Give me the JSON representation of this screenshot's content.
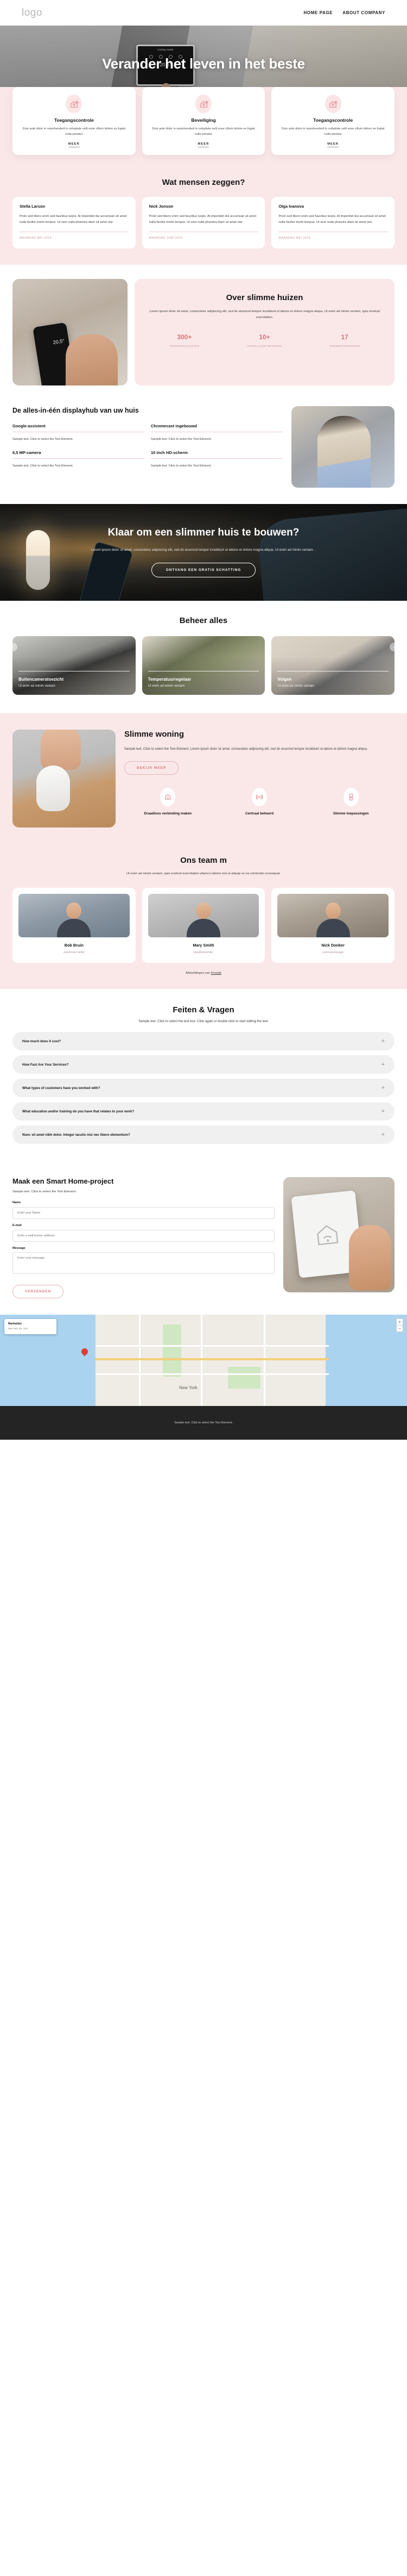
{
  "header": {
    "logo": "logo",
    "nav": [
      {
        "label": "HOME PAGE"
      },
      {
        "label": "ABOUT COMPANY"
      }
    ]
  },
  "hero": {
    "title": "Verander het leven in het beste",
    "panel_title": "Living room",
    "panel_temp": "20,5°"
  },
  "features": {
    "cards": [
      {
        "icon": "smart-home-icon",
        "title": "Toegangscontrole",
        "text": "Duis aute dolor in reprehenderit in voluptate velit esse cillum dolore eu fugiat nulla pariatur",
        "link": "MEER"
      },
      {
        "icon": "smart-home-icon",
        "title": "Beveiliging",
        "text": "Duis aute dolor in reprehenderit in voluptate velit esse cillum dolore eu fugiat nulla pariatur",
        "link": "MEER"
      },
      {
        "icon": "smart-home-icon",
        "title": "Toegangscontrole",
        "text": "Duis aute dolor in reprehenderit in voluptate velit esse cillum dolore eu fugiat nulla pariatur",
        "link": "MEER"
      }
    ]
  },
  "testimonials": {
    "title": "Wat mensen zeggen?",
    "cards": [
      {
        "name": "Stella Larson",
        "text": "Proin sed libero enim sed faucibus turpis. At imperdiet dui accumsan sit amet nulla facilisi morbi tempus. Ut sem nulla pharetra diam sit amet nisl.",
        "date": "MAANDAG MEI 2024"
      },
      {
        "name": "Nick Jonson",
        "text": "Proin sed libero enim sed faucibus turpis. At imperdiet dui accumsan sit amet nulla facilisi morbi tempus. Ut sem nulla pharetra diam sit amet nisl.",
        "date": "MAANDAG JUNI 2024"
      },
      {
        "name": "Olga Ivanova",
        "text": "Proin sed libero enim sed faucibus turpis. At imperdiet dui accumsan sit amet nulla facilisi morbi tempus. Ut sem nulla pharetra diam sit amet nisl.",
        "date": "MAANDAG MEI 2024"
      }
    ]
  },
  "about": {
    "title": "Over slimme huizen",
    "text": "Lorem ipsum dolor sit amet, consectetur adipiscing elit, sed do eiusmod tempor incididunt ut labore et dolore magna aliqua. Ut enim ad minim veniam, quis nostrud exercitation.",
    "phone_temp": "20,5°",
    "stats": [
      {
        "num": "300+",
        "label": "TEVREDEN KLANTEN"
      },
      {
        "num": "10+",
        "label": "JARENLANGE ERVARING"
      },
      {
        "num": "17",
        "label": "ONDERSCHEIDINGEN"
      }
    ]
  },
  "hub": {
    "title": "De alles-in-één displayhub van uw huis",
    "items": [
      {
        "title": "Google-assistent",
        "text": "Sample text. Click to select the Text Element."
      },
      {
        "title": "Chromecast ingebouwd",
        "text": "Sample text. Click to select the Text Element."
      },
      {
        "title": "6,5 MP-camera",
        "text": "Sample text. Click to select the Text Element."
      },
      {
        "title": "10 inch HD-scherm",
        "text": "Sample text. Click to select the Text Element."
      }
    ]
  },
  "cta": {
    "title": "Klaar om een slimmer huis te bouwen?",
    "text": "Lorem ipsum dolor sit amet, consectetur adipiscing elit, sed do eiusmod tempor incididunt ut labore et dolore magna aliqua. Ut enim ad minim veniam. .",
    "button": "ONTVANG EEN GRATIS SCHATTING"
  },
  "gallery": {
    "title": "Beheer alles",
    "prev_icon": "chevron-left-icon",
    "next_icon": "chevron-right-icon",
    "items": [
      {
        "title": "Buitencameratoezicht",
        "text": "Ut enim ad minim veniam"
      },
      {
        "title": "Temperatuurregelaar",
        "text": "Ut enim ad minim veniam"
      },
      {
        "title": "Volgen",
        "text": "Ut enim ad minim veniam"
      }
    ]
  },
  "smart": {
    "title": "Slimme woning",
    "text": "Sample text. Click to select the Text Element. Lorem ipsum dolor sit amet, consectetur adipiscing elit, sed do eiusmod tempor incididunt ut labore et dolore magna aliqua.",
    "button": "BEKIJK MEER",
    "minis": [
      {
        "icon": "home-wifi-icon",
        "label": "Draadloos verbinding maken"
      },
      {
        "icon": "signal-waves-icon",
        "label": "Centraal beheerd"
      },
      {
        "icon": "phone-home-icon",
        "label": "Slimme toepassingen"
      }
    ]
  },
  "team": {
    "title": "Ons team m",
    "subtitle": "Ut enim ad minim veniam, quis nostrud exercitation ullamco laboris nisi ut aliquip ex ea commodo consequat.",
    "members": [
      {
        "name": "Bob Bruin",
        "role": "zakenman beller"
      },
      {
        "name": "Mary Smith",
        "role": "klantbeheerder"
      },
      {
        "name": "Nick Donker",
        "role": "verkoopmanager"
      }
    ],
    "credit_prefix": "Afbeeldingen van ",
    "credit_link": "Freepik"
  },
  "faq": {
    "title": "Feiten & Vragen",
    "subtitle": "Sample text. Click to select the text box. Click again or double click to start editing the text.",
    "toggle_icon": "plus-icon",
    "items": [
      {
        "question": "How much does it cost?"
      },
      {
        "question": "How Fast Are Your Services?"
      },
      {
        "question": "What types of customers have you worked with?"
      },
      {
        "question": "What education and/or training do you have that relates to your work?"
      },
      {
        "question": "Nunc sit amet nibh dolor. Integer iaculis nisi nec libero elementum?"
      }
    ]
  },
  "contact": {
    "title": "Maak een Smart Home-project",
    "subtitle": "Sample text. Click to select the Text Element.",
    "fields": [
      {
        "label": "Name",
        "placeholder": "Enter your Name",
        "value": ""
      },
      {
        "label": "E-mail",
        "placeholder": "Enter a well-known address",
        "value": ""
      },
      {
        "label": "Message",
        "placeholder": "Enter your message",
        "value": ""
      }
    ],
    "button": "VERZENDEN"
  },
  "map": {
    "card_title": "Manhattan",
    "card_sub": "New York, NY, USA",
    "city_label": "New York",
    "pin_icon": "map-pin-icon",
    "zoom_in": "+",
    "zoom_out": "−"
  },
  "footer": {
    "text": "Sample text. Click to select the Text Element."
  },
  "colors": {
    "accent": "#d8737a",
    "pink_bg": "#fae8e8",
    "dark": "#242424"
  }
}
